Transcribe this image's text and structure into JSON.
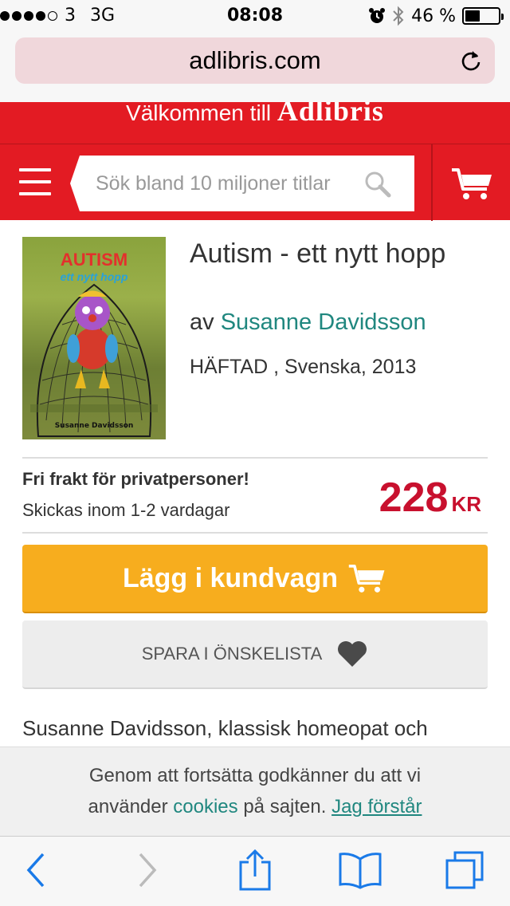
{
  "statusbar": {
    "carrier": "3",
    "network": "3G",
    "time": "08:08",
    "battery": "46 %",
    "battery_level": 0.46
  },
  "browser": {
    "url": "adlibris.com"
  },
  "banner": {
    "welcome": "Välkommen till",
    "brand": "Adlibris"
  },
  "header": {
    "search_placeholder": "Sök bland 10 miljoner titlar"
  },
  "product": {
    "title": "Autism - ett nytt hopp",
    "author_prefix": "av",
    "author": "Susanne Davidsson",
    "format": "HÄFTAD , Svenska, 2013",
    "cover": {
      "title": "AUTISM",
      "subtitle": "ett nytt hopp",
      "author": "Susanne Davidsson"
    }
  },
  "shipping": {
    "line1": "Fri frakt för privatpersoner!",
    "line2": "Skickas inom 1-2 vardagar"
  },
  "price": {
    "amount": "228",
    "currency": "KR"
  },
  "buttons": {
    "buy": "Lägg i kundvagn",
    "wishlist": "SPARA I ÖNSKELISTA"
  },
  "description_preview": "Susanne Davidsson, klassisk homeopat och",
  "cookie": {
    "line1": "Genom att fortsätta godkänner du att vi",
    "pre": "använder",
    "link": "cookies",
    "mid": "på sajten.",
    "accept": "Jag förstår"
  },
  "colors": {
    "brand_red": "#e31b23",
    "accent_orange": "#f7ad1e",
    "link_teal": "#20877f",
    "price_red": "#c8102e"
  },
  "icons": [
    "menu-icon",
    "search-icon",
    "cart-icon",
    "heart-icon",
    "reload-icon",
    "back-icon",
    "forward-icon",
    "share-icon",
    "bookmarks-icon",
    "tabs-icon"
  ]
}
